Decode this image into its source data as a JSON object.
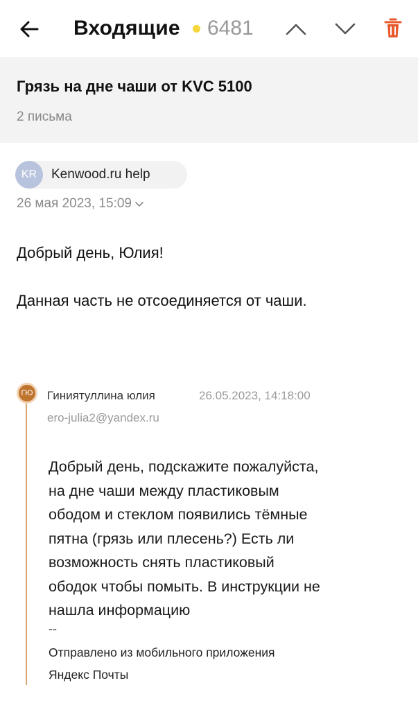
{
  "header": {
    "folder_title": "Входящие",
    "unread_count": "6481"
  },
  "thread": {
    "subject": "Грязь на дне чаши от KVC 5100",
    "count_text": "2 письма"
  },
  "message": {
    "sender_initials": "KR",
    "sender_name": "Kenwood.ru help",
    "date": "26 мая 2023, 15:09",
    "greeting": "Добрый день, Юлия!",
    "text": "Данная часть не отсоединяется от чаши."
  },
  "quoted": {
    "avatar_initials": "ГЮ",
    "name": "Гиниятуллина юлия",
    "date": "26.05.2023, 14:18:00",
    "email": "ero-julia2@yandex.ru",
    "lines": [
      "Добрый день, подскажите пожалуйста,",
      "на дне чаши между пластиковым",
      "ободом и стеклом появились тёмные",
      "пятна (грязь или плесень?) Есть ли",
      "возможность снять пластиковый",
      "ободок чтобы помыть. В инструкции не",
      "нашла информацию"
    ],
    "signature_separator": "--",
    "signature_line1": "Отправлено из мобильного приложения",
    "signature_line2": "Яндекс Почты"
  },
  "colors": {
    "unread_dot": "#f5d63d",
    "trash": "#e8582a",
    "quote_bar": "#d6a676",
    "quote_avatar": "#c0752f",
    "sender_avatar": "#b8c4dd"
  },
  "icons": {
    "back": "arrow-left-icon",
    "prev": "chevron-up-icon",
    "next": "chevron-down-icon",
    "delete": "trash-icon",
    "date_expand": "chevron-down-small-icon"
  }
}
